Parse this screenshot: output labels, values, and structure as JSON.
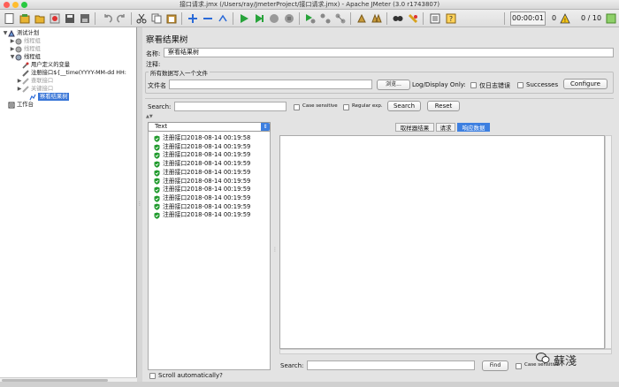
{
  "window": {
    "title": "接口请求.jmx (/Users/ray/JmeterProject/接口请求.jmx) - Apache JMeter (3.0 r1743807)"
  },
  "toolbar": {
    "timer": "00:00:01",
    "errors": "0",
    "threads": "0 / 10",
    "warning_icon": "warning-triangle-icon"
  },
  "tree": {
    "nodes": [
      {
        "label": "测试计划",
        "toggle": "▼",
        "icon": "test-plan-icon",
        "grey": false
      },
      {
        "label": "线程组",
        "toggle": "▶",
        "icon": "gear-icon",
        "grey": true
      },
      {
        "label": "线程组",
        "toggle": "▶",
        "icon": "gear-icon",
        "grey": true
      },
      {
        "label": "线程组",
        "toggle": "▼",
        "icon": "gear-icon",
        "grey": false
      },
      {
        "label": "用户定义的变量",
        "toggle": "",
        "icon": "wrench-icon",
        "grey": false
      },
      {
        "label": "注册接口${__time(YYYY-MM-dd HH:",
        "toggle": "",
        "icon": "pencil-icon",
        "grey": false
      },
      {
        "label": "查联接口",
        "toggle": "▶",
        "icon": "pencil-icon",
        "grey": true
      },
      {
        "label": "关键接口",
        "toggle": "▶",
        "icon": "pencil-icon",
        "grey": true
      },
      {
        "label": "察看结果树",
        "toggle": "",
        "icon": "chart-icon",
        "grey": false,
        "selected": true
      },
      {
        "label": "工作台",
        "toggle": "",
        "icon": "workbench-icon",
        "grey": false
      }
    ]
  },
  "panel": {
    "title": "察看结果树",
    "name_label": "名称:",
    "name_value": "察看结果树",
    "comment_label": "注释:",
    "group_label": "所有数据写入一个文件",
    "file_label": "文件名",
    "browse_label": "浏览...",
    "log_display_label": "Log/Display Only:",
    "errors_only_label": "仅日志错误",
    "successes_label": "Successes",
    "configure_label": "Configure"
  },
  "search": {
    "label": "Search:",
    "case_label": "Case sensitive",
    "regex_label": "Regular exp.",
    "search_button": "Search",
    "reset_button": "Reset"
  },
  "results": {
    "renderer": "Text",
    "items": [
      "注册接口2018-08-14 00:19:58",
      "注册接口2018-08-14 00:19:59",
      "注册接口2018-08-14 00:19:59",
      "注册接口2018-08-14 00:19:59",
      "注册接口2018-08-14 00:19:59",
      "注册接口2018-08-14 00:19:59",
      "注册接口2018-08-14 00:19:59",
      "注册接口2018-08-14 00:19:59",
      "注册接口2018-08-14 00:19:59",
      "注册接口2018-08-14 00:19:59"
    ],
    "scroll_auto": "Scroll automatically?"
  },
  "detail": {
    "tabs": [
      "取样器结果",
      "请求",
      "响应数据"
    ],
    "search_label": "Search:",
    "find_button": "Find",
    "case_label": "Case sensitive"
  },
  "watermark": {
    "text": "蘇淺"
  },
  "colors": {
    "selection": "#3875d7",
    "tab_active": "#3d7fe0",
    "success_shield": "#1f9a2c"
  }
}
